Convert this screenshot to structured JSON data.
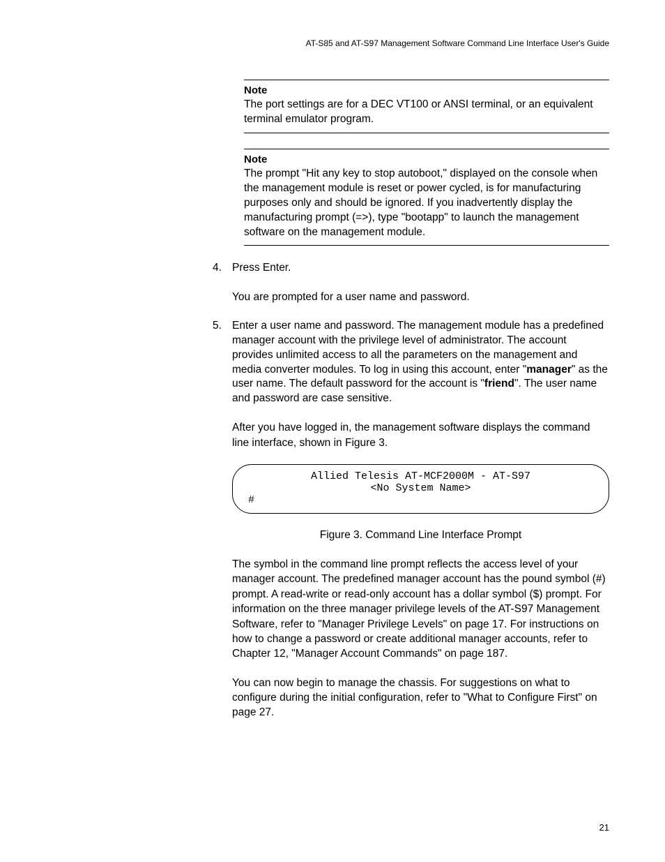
{
  "running_header": "AT-S85 and AT-S97 Management Software Command Line Interface User's Guide",
  "notes": [
    {
      "title": "Note",
      "body": "The port settings are for a DEC VT100 or ANSI terminal, or an equivalent terminal emulator program."
    },
    {
      "title": "Note",
      "body": "The prompt \"Hit any key to stop autoboot,\" displayed on the console when the management module is reset or power cycled, is for manufacturing purposes only and should be ignored. If you inadvertently display the manufacturing prompt (=>), type \"bootapp\" to launch the management software on the management module."
    }
  ],
  "steps": {
    "s4": {
      "num": "4.",
      "text": "Press Enter."
    },
    "s4_cont": "You are prompted for a user name and password.",
    "s5": {
      "num": "5.",
      "pre": "Enter a user name and password. The management module has a predefined manager account with the privilege level of administrator. The account provides unlimited access to all the parameters on the management and media converter modules. To log in using this account, enter \"",
      "b1": "manager",
      "mid": "\" as the user name. The default password for the account is \"",
      "b2": "friend",
      "post": "\". The user name and password are case sensitive."
    },
    "s5_cont": "After you have logged in, the management software displays the command line interface, shown in Figure 3."
  },
  "terminal": {
    "l1": "Allied Telesis AT-MCF2000M - AT-S97",
    "l2": "<No System Name>",
    "l3": "#"
  },
  "figure_caption": "Figure 3. Command Line Interface Prompt",
  "para1": "The symbol in the command line prompt reflects the access level of your manager account. The predefined manager account has the pound symbol (#) prompt. A read-write or read-only account has a dollar symbol ($) prompt. For information on the three manager privilege levels of the AT-S97 Management Software, refer to \"Manager Privilege Levels\" on page 17. For instructions on how to change a password or create additional manager accounts, refer to Chapter 12, \"Manager Account Commands\" on page 187.",
  "para2": "You can now begin to manage the chassis. For suggestions on what to configure during the initial configuration, refer to \"What to Configure First\" on page 27.",
  "page_number": "21"
}
